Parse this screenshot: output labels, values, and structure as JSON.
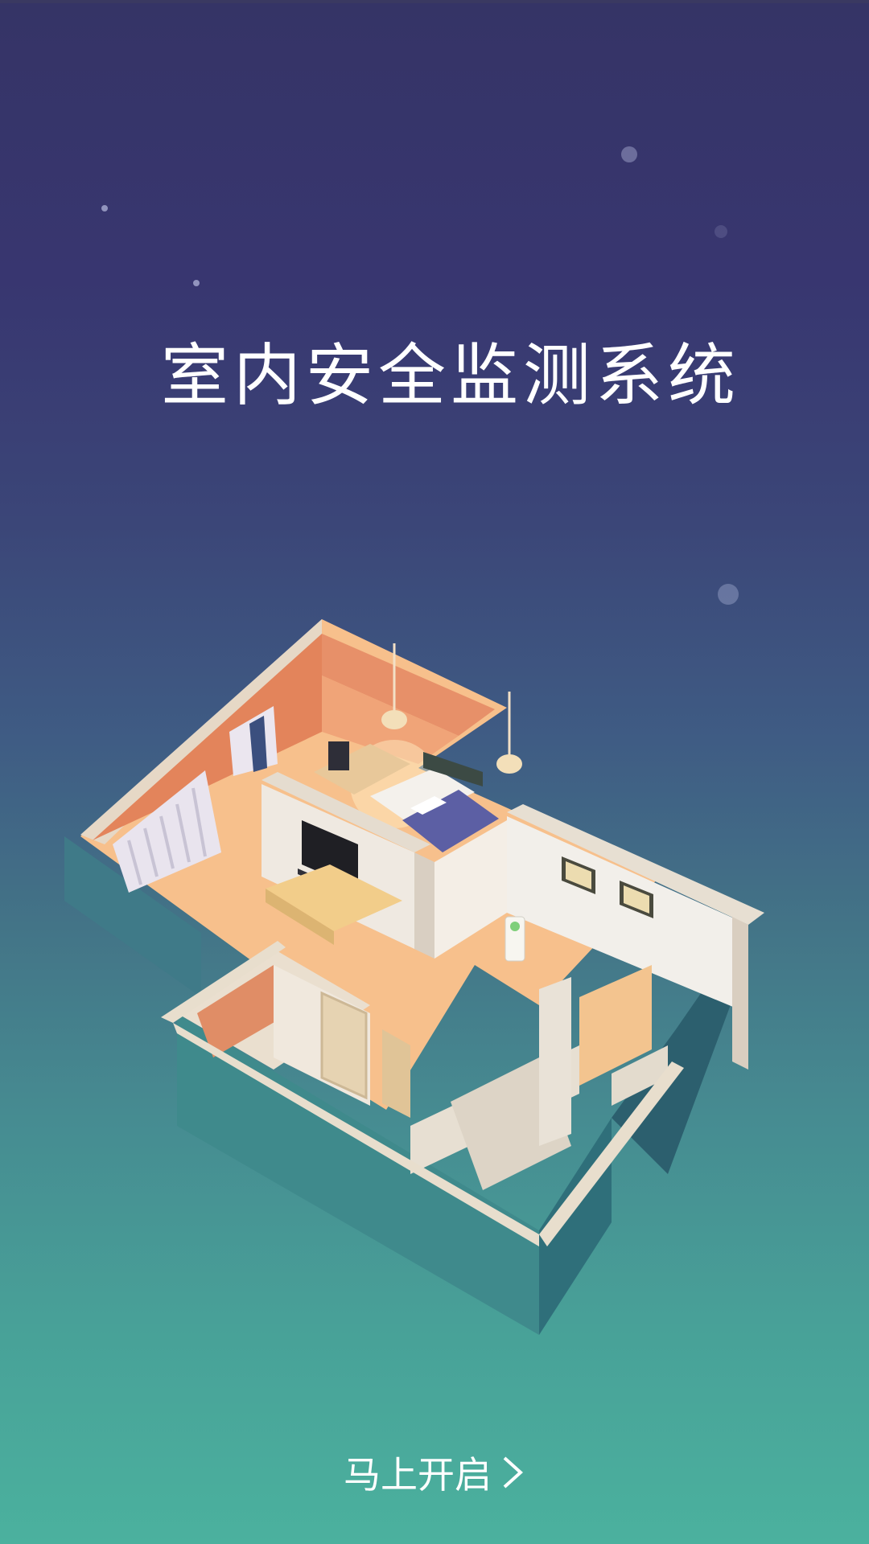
{
  "app": {
    "title": "室内安全监测系统"
  },
  "actions": {
    "start_label": "马上开启",
    "start_icon": "chevron-right-icon"
  },
  "colors": {
    "bg_top": "#353466",
    "bg_bottom": "#4bb19e",
    "text": "#ffffff",
    "room_wall_warm": "#e8895f",
    "room_floor": "#f6bd86"
  }
}
